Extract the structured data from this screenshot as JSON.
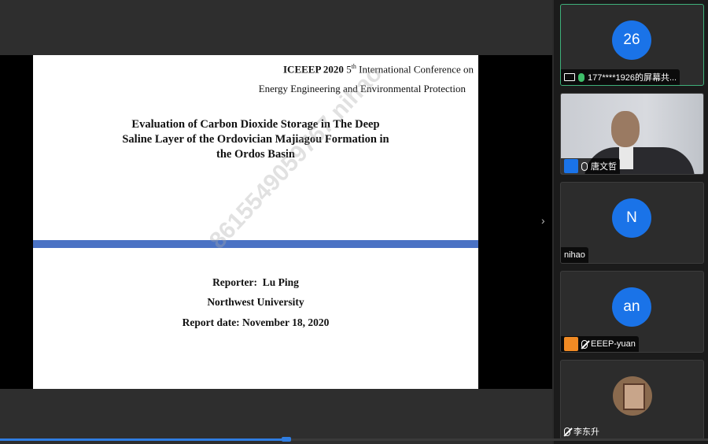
{
  "slide": {
    "header_bold": "ICEEEP 2020",
    "header_sup_pre": "5",
    "header_sup": "th",
    "header_rest": " International Conference on",
    "header_line2": "Energy Engineering and Environmental Protection",
    "title_lines": [
      "Evaluation of Carbon Dioxide Storage in The Deep",
      "Saline Layer of the Ordovician Majiagou Formation in",
      "the Ordos Basin"
    ],
    "reporter": "Reporter:  Lu Ping",
    "institution": "Northwest University",
    "report_date": "Report date: November 18, 2020",
    "watermark": "8615549059767 nihao"
  },
  "nav": {
    "next_glyph": "›"
  },
  "participants": [
    {
      "avatar_text": "26",
      "name": "177****1926的屏幕共..."
    },
    {
      "avatar_text": "",
      "name": "唐文哲"
    },
    {
      "avatar_text": "N",
      "name": "nihao"
    },
    {
      "avatar_text": "an",
      "name": "EEEP-yuan"
    },
    {
      "avatar_text": "",
      "name": "李东升"
    }
  ],
  "colors": {
    "avatar_blue": "#1a73e8",
    "active_border": "#3fb07a",
    "slide_bar": "#4a72c4"
  }
}
